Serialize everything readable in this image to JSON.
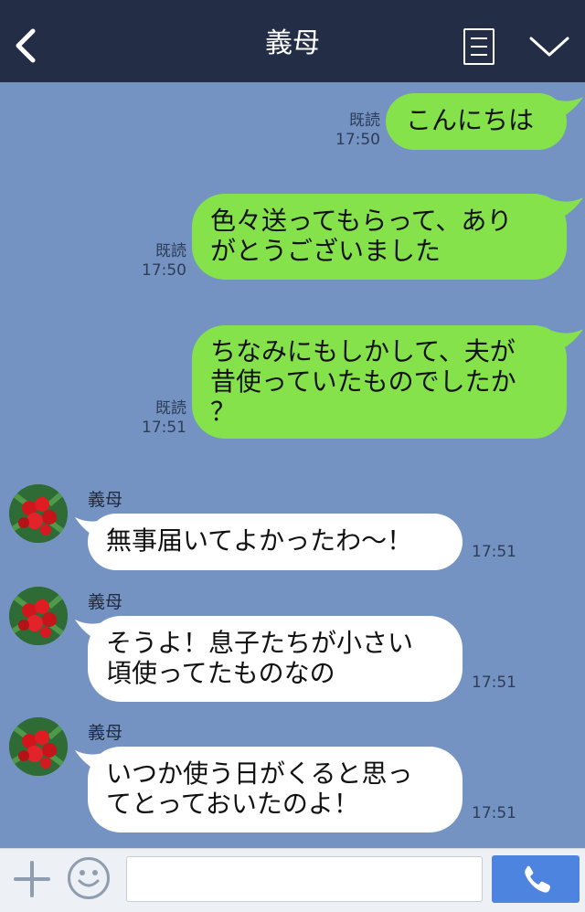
{
  "header": {
    "title": "義母"
  },
  "icons": {
    "back": "chevron-left-icon",
    "memo": "notes-icon",
    "menu": "chevron-down-icon",
    "plus": "plus-icon",
    "emoji": "smiley-icon",
    "call": "phone-icon",
    "avatar": "red-berries-avatar"
  },
  "colors": {
    "header_bg": "#232d45",
    "chat_bg": "#7493c2",
    "sent_bubble": "#85e24b",
    "received_bubble": "#ffffff",
    "call_button": "#4d84e0"
  },
  "messages": [
    {
      "direction": "sent",
      "lines": [
        "こんにちは"
      ],
      "read_label": "既読",
      "time": "17:50"
    },
    {
      "direction": "sent",
      "lines": [
        "色々送ってもらって、あり",
        "がとうございました"
      ],
      "read_label": "既読",
      "time": "17:50"
    },
    {
      "direction": "sent",
      "lines": [
        "ちなみにもしかして、夫が",
        "昔使っていたものでしたか",
        "？"
      ],
      "read_label": "既読",
      "time": "17:51"
    },
    {
      "direction": "received",
      "sender": "義母",
      "lines": [
        "無事届いてよかったわ〜！"
      ],
      "time": "17:51"
    },
    {
      "direction": "received",
      "sender": "義母",
      "lines": [
        "そうよ！息子たちが小さい",
        "頃使ってたものなの"
      ],
      "time": "17:51"
    },
    {
      "direction": "received",
      "sender": "義母",
      "lines": [
        "いつか使う日がくると思っ",
        "てとっておいたのよ！"
      ],
      "time": "17:51"
    }
  ],
  "footer": {
    "input_value": ""
  }
}
